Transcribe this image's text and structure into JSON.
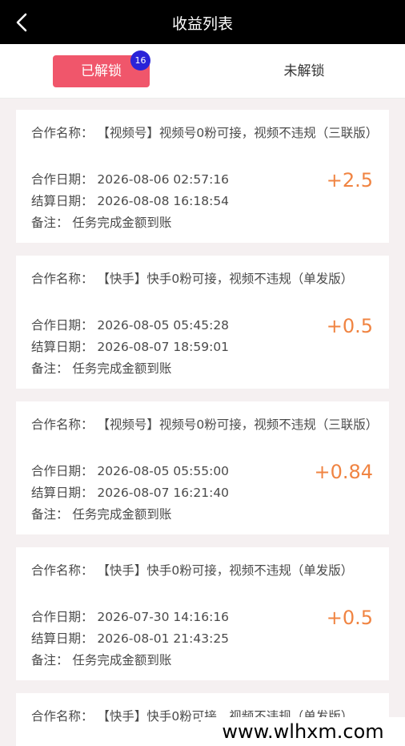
{
  "header": {
    "title": "收益列表"
  },
  "tabs": {
    "unlocked": {
      "label": "已解锁",
      "badge": "16"
    },
    "locked": {
      "label": "未解锁"
    }
  },
  "cards": [
    {
      "name": "合作名称：  【视频号】视频号0粉可接，视频不违规（三联版）",
      "coop_date": "合作日期：  2026-08-06 02:57:16",
      "settle_date": "结算日期：  2026-08-08 16:18:54",
      "remark": "备注：  任务完成金额到账",
      "amount": "+2.5"
    },
    {
      "name": "合作名称：  【快手】快手0粉可接，视频不违规（单发版）",
      "coop_date": "合作日期：  2026-08-05 05:45:28",
      "settle_date": "结算日期：  2026-08-07 18:59:01",
      "remark": "备注：  任务完成金额到账",
      "amount": "+0.5"
    },
    {
      "name": "合作名称：  【视频号】视频号0粉可接，视频不违规（三联版）",
      "coop_date": "合作日期：  2026-08-05 05:55:00",
      "settle_date": "结算日期：  2026-08-07 16:21:40",
      "remark": "备注：  任务完成金额到账",
      "amount": "+0.84"
    },
    {
      "name": "合作名称：  【快手】快手0粉可接，视频不违规（单发版）",
      "coop_date": "合作日期：  2026-07-30 14:16:16",
      "settle_date": "结算日期：  2026-08-01 21:43:25",
      "remark": "备注：  任务完成金额到账",
      "amount": "+0.5"
    },
    {
      "name": "合作名称：  【快手】快手0粉可接，视频不违规（单发版）"
    }
  ],
  "watermark": "www.wlhxm.com"
}
